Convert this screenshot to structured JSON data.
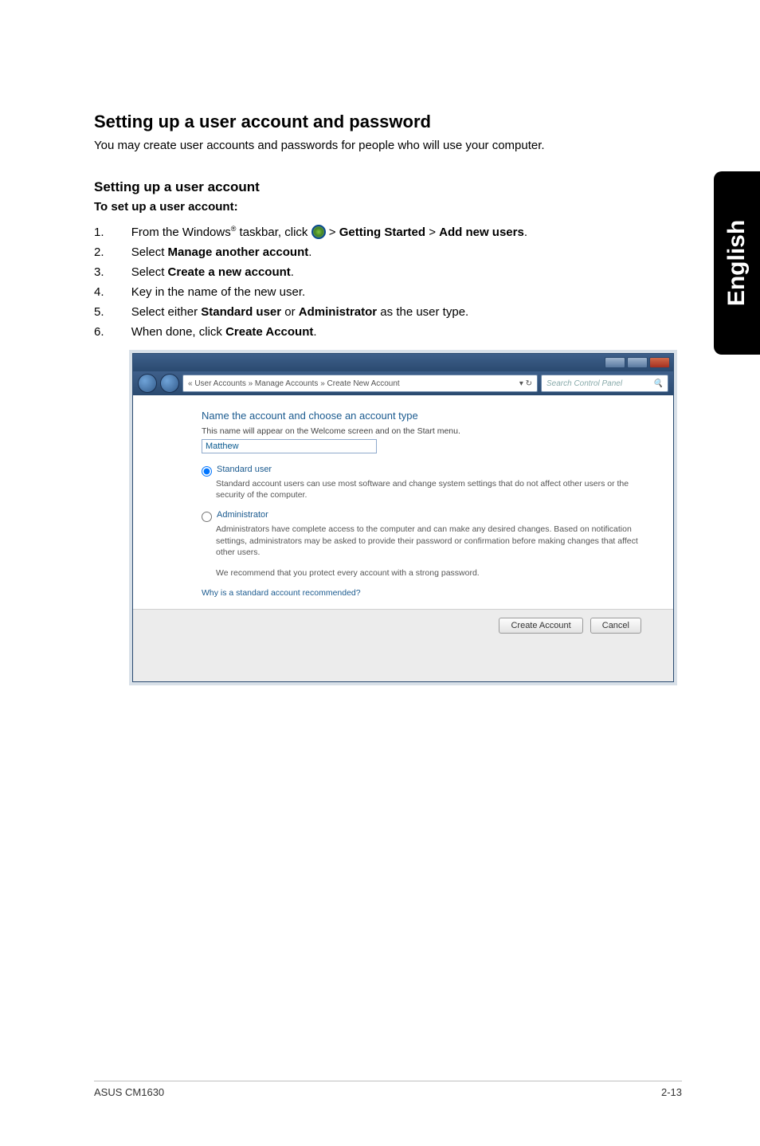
{
  "side_tab": "English",
  "heading": "Setting up a user account and password",
  "intro": "You may create user accounts and passwords for people who will use your computer.",
  "subheading": "Setting up a user account",
  "runin": "To set up a user account:",
  "steps": {
    "s1_lead": "From the Windows",
    "s1_reg": "®",
    "s1_mid": " taskbar, click ",
    "s1_gt1": " > ",
    "s1_b1": "Getting Started",
    "s1_gt2": " > ",
    "s1_b2": "Add new users",
    "s1_end": ".",
    "s2a": "Select ",
    "s2b": "Manage another account",
    "s2c": ".",
    "s3a": "Select ",
    "s3b": "Create a new account",
    "s3c": ".",
    "s4": "Key in the name of the new user.",
    "s5a": "Select either ",
    "s5b": "Standard user",
    "s5c": " or ",
    "s5d": "Administrator",
    "s5e": " as the user type.",
    "s6a": "When done, click ",
    "s6b": "Create Account",
    "s6c": "."
  },
  "screenshot": {
    "address_bar": "« User Accounts » Manage Accounts » Create New Account",
    "search_placeholder": "Search Control Panel",
    "search_icon": "🔍",
    "title_line": "Name the account and choose an account type",
    "subtitle": "This name will appear on the Welcome screen and on the Start menu.",
    "name_value": "Matthew",
    "radio1_label": "Standard user",
    "radio1_desc": "Standard account users can use most software and change system settings that do not affect other users or the security of the computer.",
    "radio2_label": "Administrator",
    "radio2_desc": "Administrators have complete access to the computer and can make any desired changes. Based on notification settings, administrators may be asked to provide their password or confirmation before making changes that affect other users.",
    "recommend": "We recommend that you protect every account with a strong password.",
    "why_link": "Why is a standard account recommended?",
    "btn_create": "Create Account",
    "btn_cancel": "Cancel"
  },
  "footer": {
    "left": "ASUS CM1630",
    "right": "2-13"
  }
}
